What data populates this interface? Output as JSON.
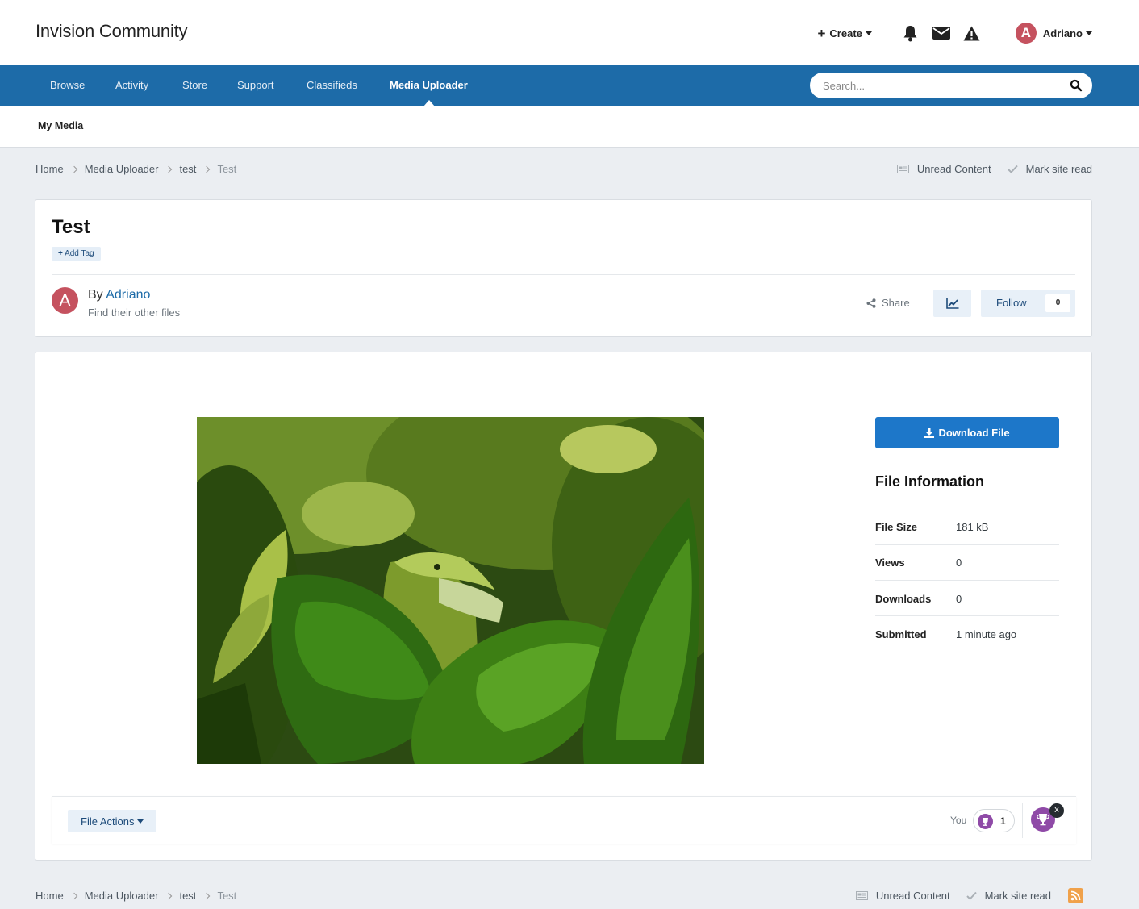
{
  "header": {
    "site_title": "Invision Community",
    "create_label": "Create",
    "user_name": "Adriano",
    "user_initial": "A"
  },
  "nav": {
    "items": [
      "Browse",
      "Activity",
      "Store",
      "Support",
      "Classifieds",
      "Media Uploader"
    ],
    "active": "Media Uploader",
    "search_placeholder": "Search..."
  },
  "subnav": {
    "items": [
      "My Media"
    ]
  },
  "breadcrumb": {
    "items": [
      "Home",
      "Media Uploader",
      "test",
      "Test"
    ],
    "unread_content": "Unread Content",
    "mark_site_read": "Mark site read"
  },
  "file": {
    "title": "Test",
    "add_tag": "Add Tag",
    "by_prefix": "By",
    "author": "Adriano",
    "author_initial": "A",
    "find_other": "Find their other files",
    "share": "Share",
    "follow": "Follow",
    "follow_count": "0"
  },
  "sidebar": {
    "download": "Download File",
    "info_title": "File Information",
    "rows": [
      {
        "key": "File Size",
        "value": "181 kB"
      },
      {
        "key": "Views",
        "value": "0"
      },
      {
        "key": "Downloads",
        "value": "0"
      },
      {
        "key": "Submitted",
        "value": "1 minute ago"
      }
    ]
  },
  "actions": {
    "file_actions": "File Actions",
    "you": "You",
    "reaction_count": "1",
    "close": "x"
  },
  "colors": {
    "brand": "#1d6ba8",
    "download": "#1d77c9",
    "avatar": "#c5525f",
    "reaction": "#8f4aa7"
  }
}
